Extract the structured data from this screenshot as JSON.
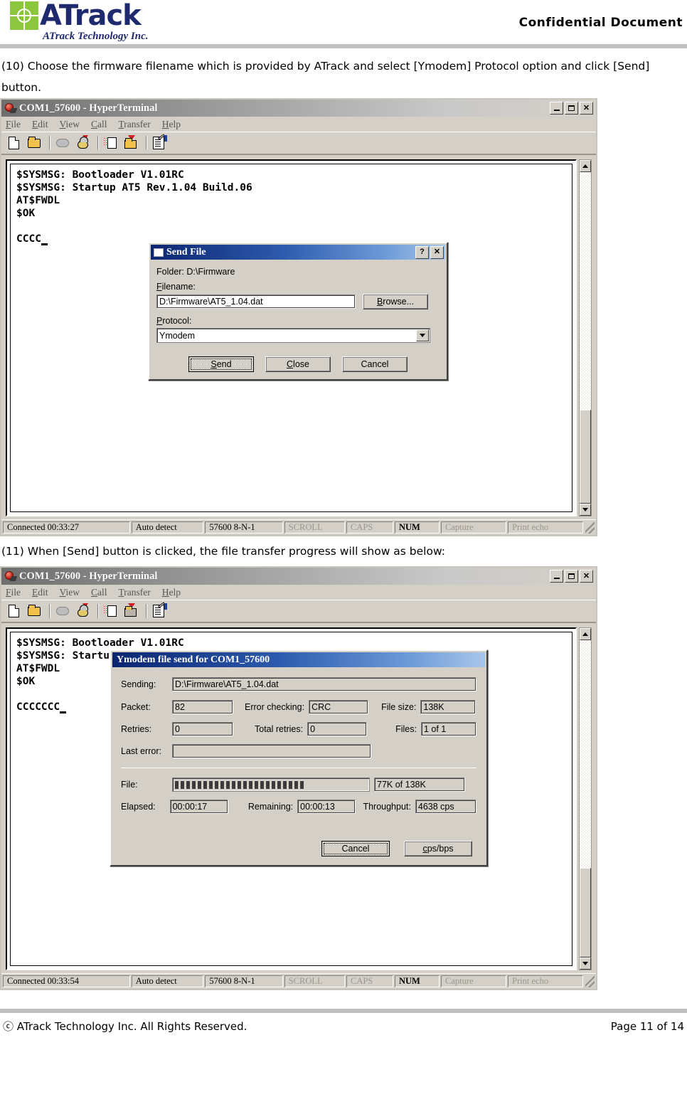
{
  "header": {
    "logo_word": "ATrack",
    "logo_sub": "ATrack Technology Inc.",
    "confidential": "Confidential  Document"
  },
  "steps": {
    "step10": "(10) Choose the firmware filename which is provided by ATrack and select [Ymodem] Protocol option and click [Send] button.",
    "step11": "(11) When [Send] button is clicked, the file transfer progress will show as below:"
  },
  "terminal1": {
    "title": "COM1_57600 - HyperTerminal",
    "menu": [
      {
        "pre": "F",
        "rest": "ile"
      },
      {
        "pre": "E",
        "rest": "dit"
      },
      {
        "pre": "V",
        "rest": "iew"
      },
      {
        "pre": "C",
        "rest": "all"
      },
      {
        "pre": "T",
        "rest": "ransfer"
      },
      {
        "pre": "H",
        "rest": "elp"
      }
    ],
    "lines": [
      "$SYSMSG: Bootloader V1.01RC",
      "$SYSMSG: Startup AT5 Rev.1.04 Build.06",
      "AT$FWDL",
      "$OK",
      "",
      "CCCC"
    ],
    "status": {
      "connected": "Connected 00:33:27",
      "detect": "Auto detect",
      "line": "57600 8-N-1",
      "scroll": "SCROLL",
      "caps": "CAPS",
      "num": "NUM",
      "capture": "Capture",
      "printecho": "Print echo"
    }
  },
  "send_file_dialog": {
    "title": "Send File",
    "help_btn": "?",
    "close_btn": "✕",
    "folder_label": "Folder:  D:\\Firmware",
    "filename_label_pre": "F",
    "filename_label_rest": "ilename:",
    "filename_value": "D:\\Firmware\\AT5_1.04.dat",
    "browse_pre": "B",
    "browse_rest": "rowse...",
    "protocol_label_pre": "P",
    "protocol_label_rest": "rotocol:",
    "protocol_value": "Ymodem",
    "protocol_options": [
      "Ymodem"
    ],
    "send_pre": "S",
    "send_rest": "end",
    "close_pre": "C",
    "close_rest": "lose",
    "cancel_label": "Cancel"
  },
  "terminal2": {
    "title": "COM1_57600 - HyperTerminal",
    "menu": [
      {
        "pre": "F",
        "rest": "ile"
      },
      {
        "pre": "E",
        "rest": "dit"
      },
      {
        "pre": "V",
        "rest": "iew"
      },
      {
        "pre": "C",
        "rest": "all"
      },
      {
        "pre": "T",
        "rest": "ransfer"
      },
      {
        "pre": "H",
        "rest": "elp"
      }
    ],
    "lines": [
      "$SYSMSG: Bootloader V1.01RC",
      "$SYSMSG: Startup",
      "AT$FWDL",
      "$OK",
      "",
      "CCCCCCC"
    ],
    "status": {
      "connected": "Connected 00:33:54",
      "detect": "Auto detect",
      "line": "57600 8-N-1",
      "scroll": "SCROLL",
      "caps": "CAPS",
      "num": "NUM",
      "capture": "Capture",
      "printecho": "Print echo"
    }
  },
  "ymodem_dialog": {
    "title": "Ymodem file send for COM1_57600",
    "sending_label": "Sending:",
    "sending_value": "D:\\Firmware\\AT5_1.04.dat",
    "packet_label": "Packet:",
    "packet_value": "82",
    "error_checking_label": "Error checking:",
    "error_checking_value": "CRC",
    "file_size_label": "File size:",
    "file_size_value": "138K",
    "retries_label": "Retries:",
    "retries_value": "0",
    "total_retries_label": "Total retries:",
    "total_retries_value": "0",
    "files_label": "Files:",
    "files_value": "1 of 1",
    "last_error_label": "Last error:",
    "last_error_value": "",
    "file_label": "File:",
    "file_progress_blocks": 23,
    "file_progress_total": 50,
    "file_progress_text": "77K of 138K",
    "elapsed_label": "Elapsed:",
    "elapsed_value": "00:00:17",
    "remaining_label": "Remaining:",
    "remaining_value": "00:00:13",
    "throughput_label": "Throughput:",
    "throughput_value": "4638 cps",
    "cancel_label": "Cancel",
    "cpsbps_pre": "c",
    "cpsbps_rest": "ps/bps"
  },
  "footer": {
    "copyright": "ⓒ ATrack Technology Inc. All Rights Reserved.",
    "page": "Page 11 of 14"
  },
  "colors": {
    "brand_navy": "#1F2A6E",
    "brand_green": "#8CC63E",
    "dialog_face": "#D4D0C8",
    "title_blue": "#0A2570",
    "rule_gray": "#BFBFBF"
  }
}
